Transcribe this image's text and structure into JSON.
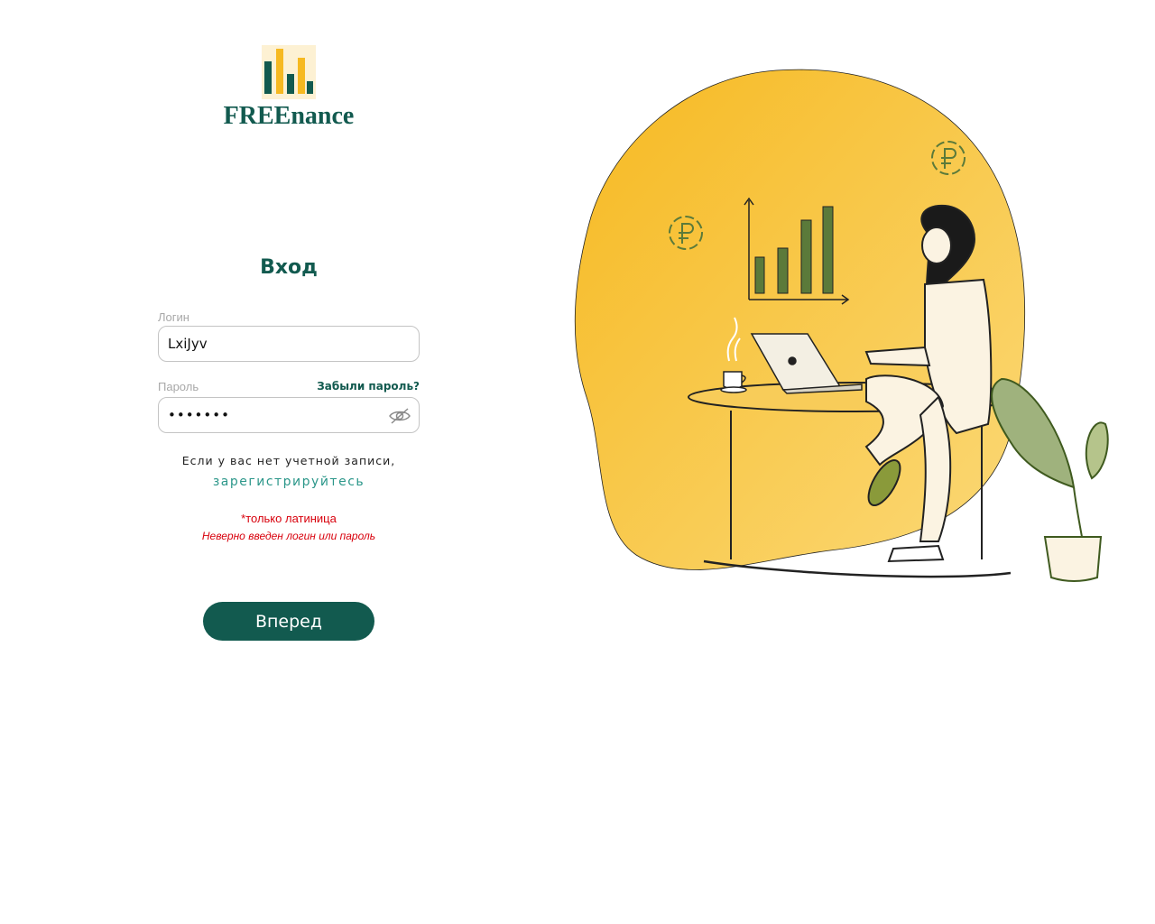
{
  "brand": {
    "name": "FREEnance",
    "logo_icon": "bar-chart-logo-icon",
    "colors": {
      "primary": "#125a4f",
      "accent": "#f6b921",
      "error": "#d8000c",
      "link": "#2c978a"
    }
  },
  "form": {
    "title": "Вход",
    "login": {
      "label": "Логин",
      "value": "LxiJyv"
    },
    "password": {
      "label": "Пароль",
      "value": "•••••••",
      "forgot_label": "Забыли пароль?",
      "toggle_icon": "eye-slash-icon"
    },
    "no_account_text": "Если у вас нет учетной записи,",
    "register_link": "зарегистрируйтесь",
    "hint": "*только латиница",
    "error": "Неверно введен логин или пароль",
    "submit_label": "Вперед"
  },
  "illustration": {
    "icons": [
      "ruble-coin-icon",
      "bar-chart-icon",
      "laptop-icon",
      "coffee-cup-icon",
      "plant-icon"
    ]
  }
}
